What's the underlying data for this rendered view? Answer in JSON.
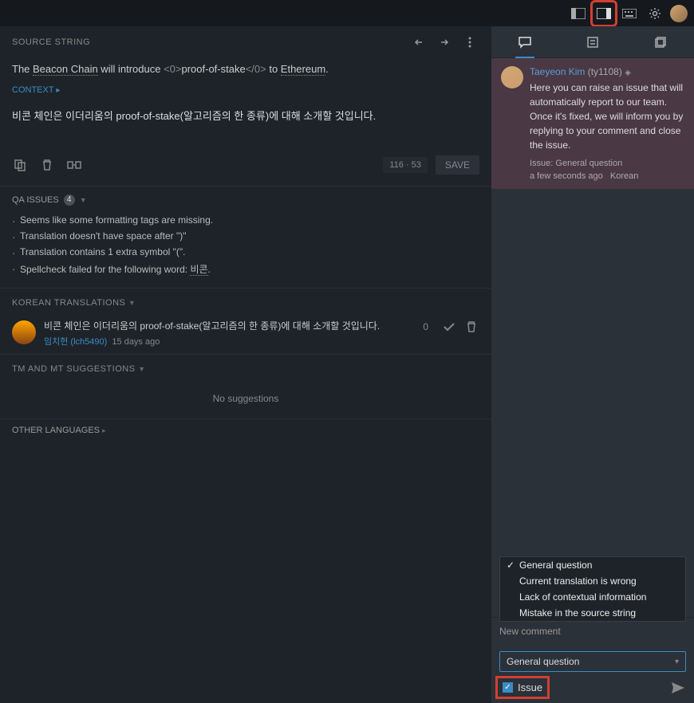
{
  "topbar": {
    "view_mode_1": "panel-left",
    "view_mode_2": "panel-right",
    "view_mode_3": "keyboard",
    "active_view": 2
  },
  "source": {
    "header": "SOURCE STRING",
    "text_parts": {
      "p1": "The ",
      "p2": "Beacon Chain",
      "p3": " will introduce ",
      "tag1": "<0>",
      "p4": "proof-of-stake",
      "tag2": "</0>",
      "p5": " to ",
      "p6": "Ethereum",
      "p7": "."
    },
    "context_label": "CONTEXT"
  },
  "translation": {
    "text": "비콘 체인은 이더리움의 proof-of-stake(알고리즘의 한 종류)에 대해 소개할 것입니다."
  },
  "toolbar": {
    "char_count": "116  ·  53",
    "save_label": "SAVE"
  },
  "qa": {
    "header": "QA ISSUES",
    "count": "4",
    "items": [
      "Seems like some formatting tags are missing.",
      "Translation doesn't have space after \")\"",
      "Translation contains 1 extra symbol \"(\"."
    ],
    "spellcheck_prefix": "Spellcheck failed for the following word: ",
    "spellcheck_word": "비콘",
    "spellcheck_suffix": "."
  },
  "korean": {
    "header": "KOREAN TRANSLATIONS",
    "item": {
      "text": "비콘 체인은 이더리움의 proof-of-stake(알고리즘의 한 종류)에 대해 소개할 것입니다.",
      "user": "임치헌 (lch5490)",
      "when": "15 days ago",
      "votes": "0"
    }
  },
  "tm": {
    "header": "TM AND MT SUGGESTIONS",
    "empty": "No suggestions"
  },
  "other": {
    "header": "OTHER LANGUAGES"
  },
  "comment": {
    "user": "Taeyeon Kim",
    "handle": "(ty1108)",
    "text": "Here you can raise an issue that will automatically report to our team. Once it's fixed, we will inform you by replying to your comment and close the issue.",
    "issue": "Issue: General question",
    "when": "a few seconds ago",
    "lang": "Korean"
  },
  "new_comment": {
    "label": "New comment",
    "options": [
      "General question",
      "Current translation is wrong",
      "Lack of contextual information",
      "Mistake in the source string"
    ],
    "selected": "General question",
    "issue_label": "Issue",
    "issue_checked": true
  }
}
